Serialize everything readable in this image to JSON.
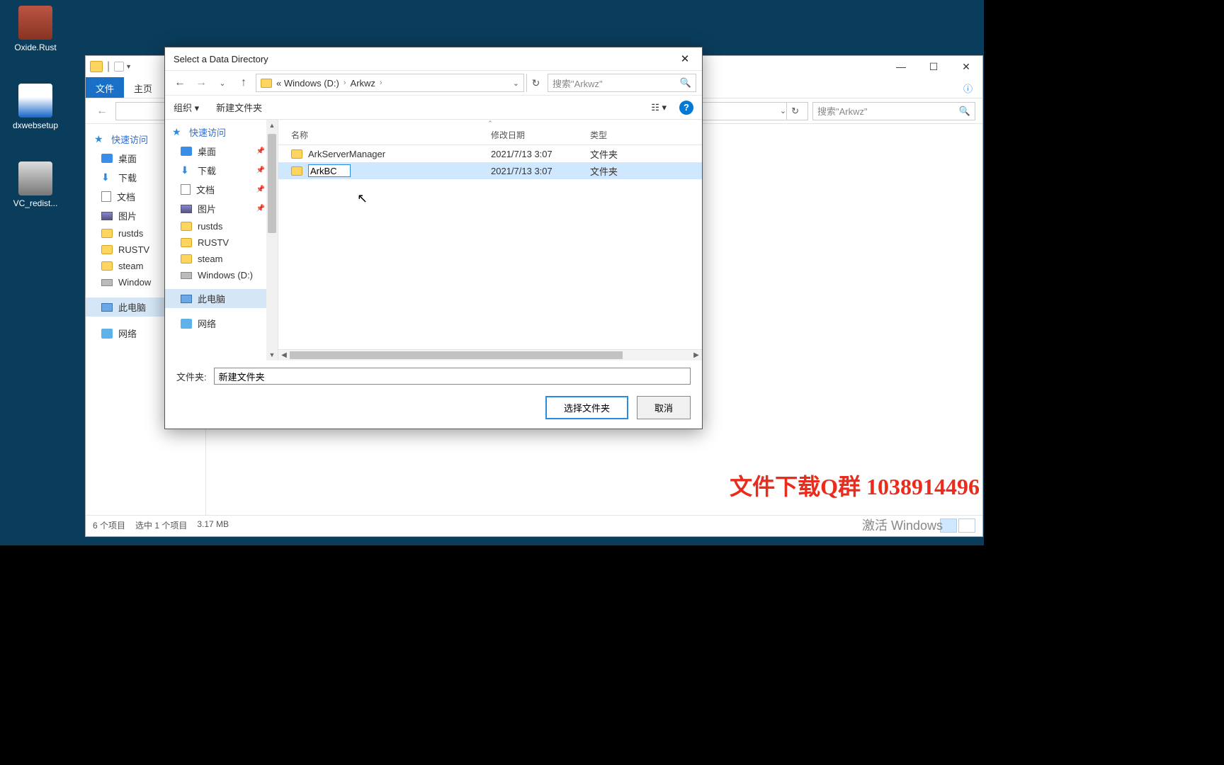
{
  "desktop": {
    "icons": [
      {
        "label": "Oxide.Rust"
      },
      {
        "label": "dxwebsetup"
      },
      {
        "label": "VC_redist..."
      }
    ]
  },
  "bg_explorer": {
    "tabs": {
      "file": "文件",
      "home": "主页"
    },
    "address": "",
    "search_placeholder": "搜索\"Arkwz\"",
    "nav": {
      "quick": "快速访问",
      "desktop": "桌面",
      "downloads": "下载",
      "documents": "文档",
      "pictures": "图片",
      "rustds": "rustds",
      "rustv": "RUSTV",
      "steam": "steam",
      "windows_d": "Window",
      "this_pc": "此电脑",
      "network": "网络"
    },
    "status": {
      "count": "6 个项目",
      "selected": "选中 1 个项目",
      "size": "3.17 MB"
    }
  },
  "dialog": {
    "title": "Select a Data Directory",
    "breadcrumb": {
      "root": "«  Windows (D:)",
      "child": "Arkwz"
    },
    "refresh_icon": "↻",
    "search_placeholder": "搜索\"Arkwz\"",
    "toolbar": {
      "organize": "组织 ▾",
      "new_folder": "新建文件夹",
      "view": "☷ ▾"
    },
    "nav": {
      "quick": "快速访问",
      "desktop": "桌面",
      "downloads": "下载",
      "documents": "文档",
      "pictures": "图片",
      "rustds": "rustds",
      "rustv": "RUSTV",
      "steam": "steam",
      "windows_d": "Windows (D:)",
      "this_pc": "此电脑",
      "network": "网络"
    },
    "columns": {
      "name": "名称",
      "modified": "修改日期",
      "type": "类型"
    },
    "rows": [
      {
        "name": "ArkServerManager",
        "date": "2021/7/13 3:07",
        "type": "文件夹"
      },
      {
        "name_edit": "ArkBC",
        "date": "2021/7/13 3:07",
        "type": "文件夹"
      }
    ],
    "folder_label": "文件夹:",
    "folder_value": "新建文件夹",
    "select_btn": "选择文件夹",
    "cancel_btn": "取消"
  },
  "overlay": {
    "text": "文件下载Q群 1038914496"
  },
  "watermark": "激活 Windows"
}
